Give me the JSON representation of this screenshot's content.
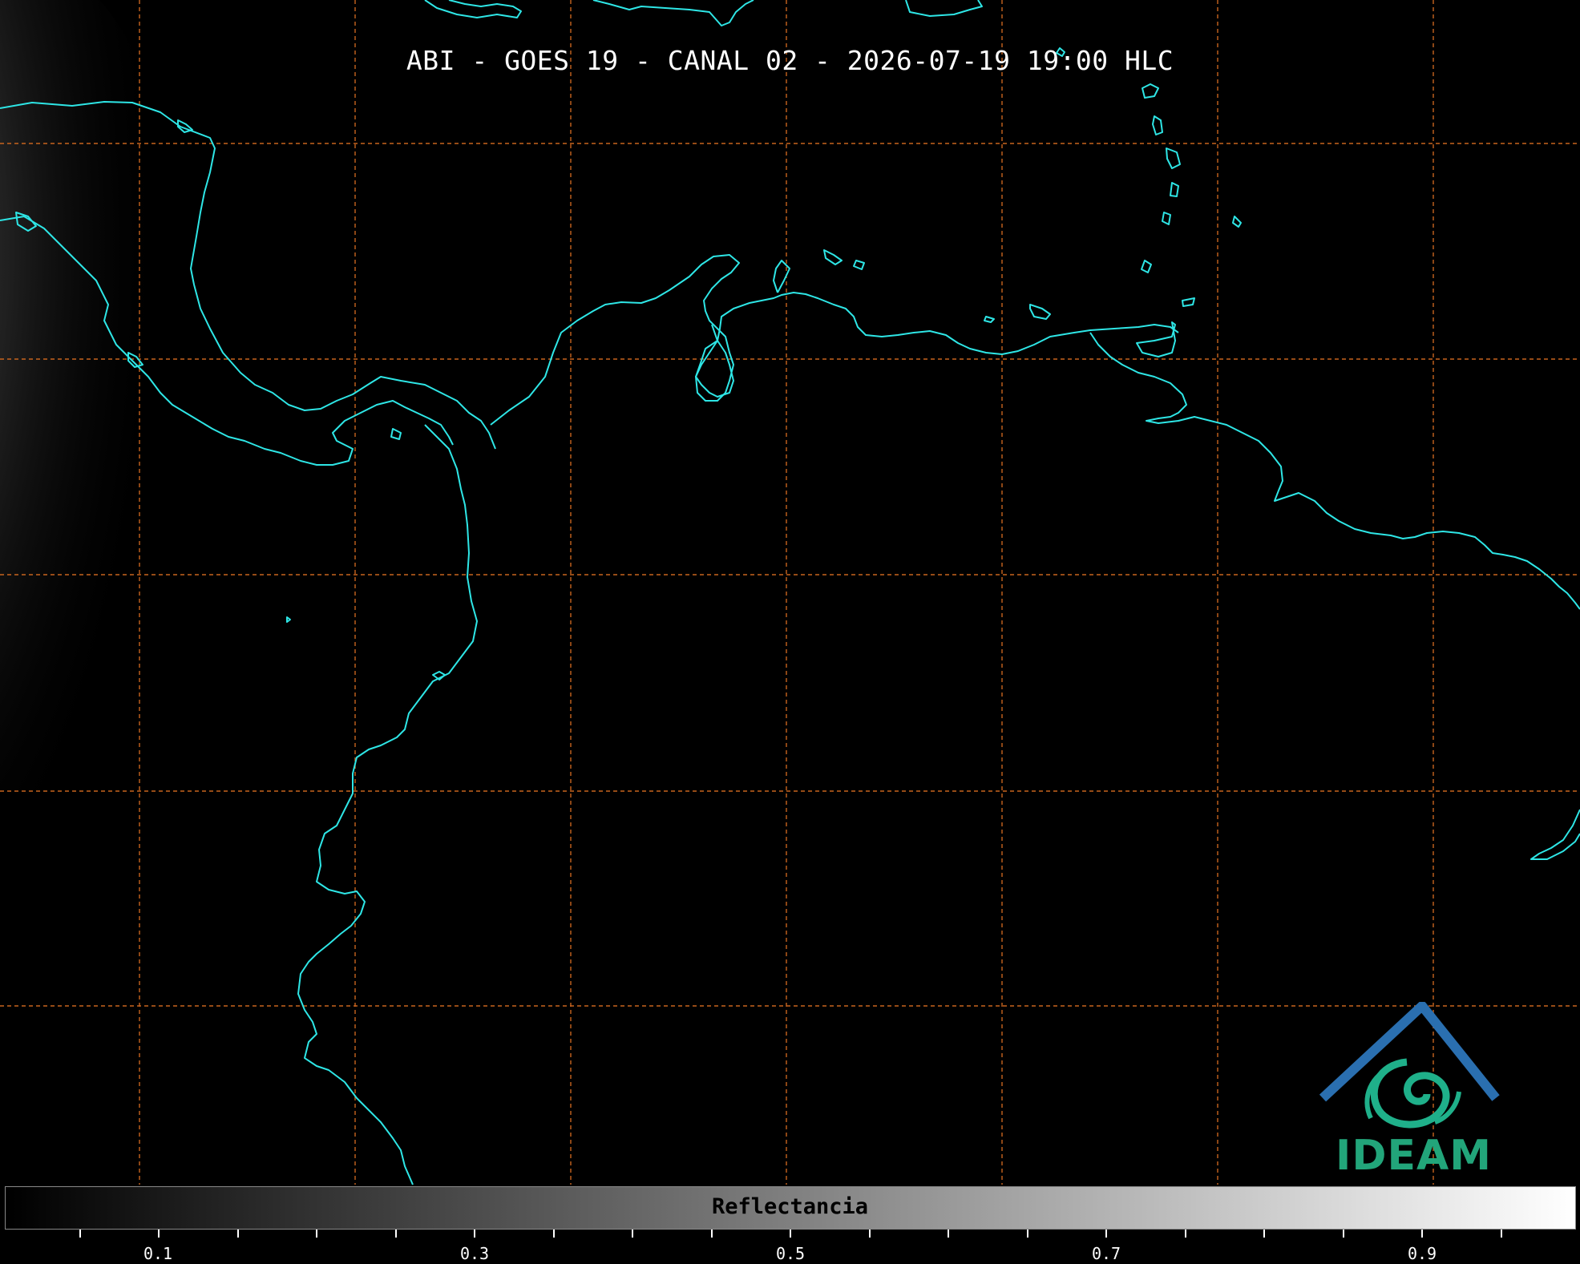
{
  "title": "ABI - GOES 19 - CANAL 02 - 2026-07-19 19:00 HLC",
  "colorbar": {
    "label": "Reflectancia",
    "tick_labels": [
      "0.1",
      "0.3",
      "0.5",
      "0.7",
      "0.9"
    ],
    "tick_values": [
      0.1,
      0.3,
      0.5,
      0.7,
      0.9
    ],
    "range": [
      0.0,
      1.0
    ],
    "gradient_from": "#000000",
    "gradient_to": "#ffffff"
  },
  "logo": {
    "text": "IDEAM",
    "colors": {
      "roof": "#2a6fb0",
      "swirl": "#1fb08a",
      "text": "#22a57a"
    }
  },
  "map": {
    "coastline_color": "#2ee6e6",
    "grid_color": "#c8641e",
    "background": "#000000"
  }
}
